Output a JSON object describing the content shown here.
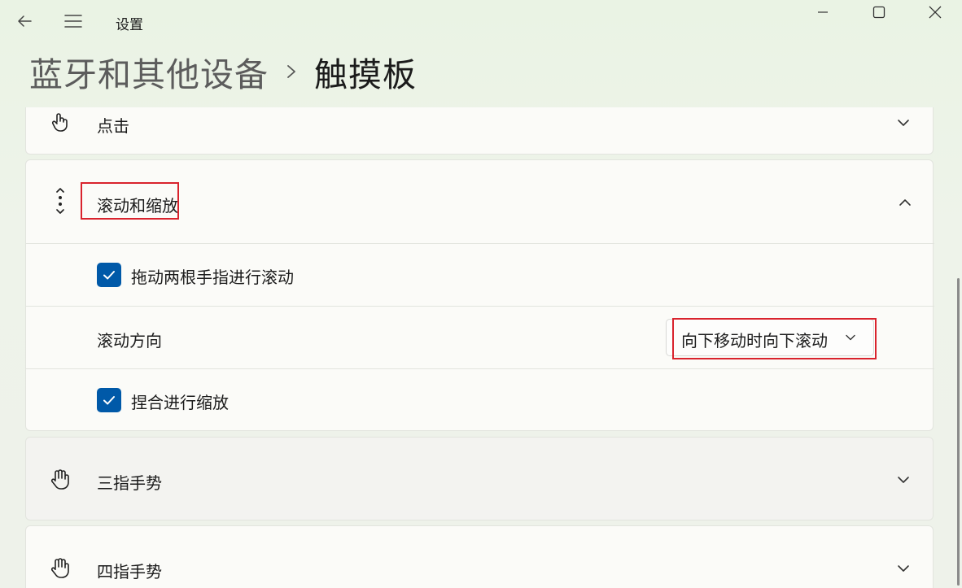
{
  "window": {
    "app_title": "设置",
    "accent_color": "#0059a8",
    "highlight_color": "#d9232d"
  },
  "titlebar": {
    "back_icon": "back-arrow-icon",
    "menu_icon": "hamburger-menu-icon"
  },
  "breadcrumb": {
    "parent": "蓝牙和其他设备",
    "separator_icon": "chevron-right-icon",
    "current": "触摸板"
  },
  "sections": {
    "taps": {
      "label": "点击",
      "icon": "tap-hand-icon",
      "expanded": false
    },
    "scroll_zoom": {
      "label": "滚动和缩放",
      "icon": "scroll-arrows-icon",
      "expanded": true,
      "two_finger_scroll": {
        "label": "拖动两根手指进行滚动",
        "checked": true
      },
      "scroll_direction": {
        "label": "滚动方向",
        "value": "向下移动时向下滚动"
      },
      "pinch_zoom": {
        "label": "捏合进行缩放",
        "checked": true
      }
    },
    "three_finger": {
      "label": "三指手势",
      "icon": "three-finger-hand-icon",
      "expanded": false
    },
    "four_finger": {
      "label": "四指手势",
      "icon": "four-finger-hand-icon",
      "expanded": false
    }
  }
}
